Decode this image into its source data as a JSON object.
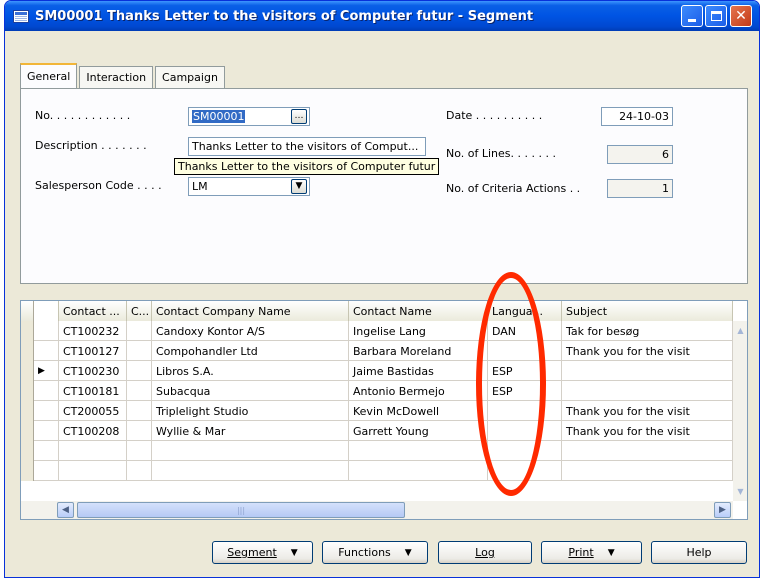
{
  "window": {
    "title": "SM00001 Thanks Letter to the visitors of Computer futur - Segment"
  },
  "tabs": [
    "General",
    "Interaction",
    "Campaign"
  ],
  "form": {
    "no_label": "No. . . . . . . . . . . .",
    "no_value": "SM00001",
    "description_label": "Description . . . . . . .",
    "description_value": "Thanks Letter to the visitors of Comput...",
    "description_tooltip": "Thanks Letter to the visitors of Computer futur",
    "salesperson_label": "Salesperson Code . . . .",
    "salesperson_value": "LM",
    "date_label": "Date . . . . . . . . . .",
    "date_value": "24-10-03",
    "lines_label": "No. of Lines. . . . . . .",
    "lines_value": "6",
    "criteria_label": "No. of Criteria Actions . .",
    "criteria_value": "1"
  },
  "grid": {
    "headers": [
      "Contact ...",
      "C...",
      "Contact Company Name",
      "Contact Name",
      "Langua...",
      "Subject"
    ],
    "rows": [
      {
        "contact": "CT100232",
        "c": "",
        "company": "Candoxy Kontor A/S",
        "name": "Ingelise Lang",
        "lang": "DAN",
        "subject": "Tak for besøg"
      },
      {
        "contact": "CT100127",
        "c": "",
        "company": "Compohandler Ltd",
        "name": "Barbara Moreland",
        "lang": "",
        "subject": "Thank you for the visit"
      },
      {
        "contact": "CT100230",
        "c": "",
        "company": "Libros S.A.",
        "name": "Jaime Bastidas",
        "lang": "ESP",
        "subject": ""
      },
      {
        "contact": "CT100181",
        "c": "",
        "company": "Subacqua",
        "name": "Antonio Bermejo",
        "lang": "ESP",
        "subject": ""
      },
      {
        "contact": "CT200055",
        "c": "",
        "company": "Triplelight Studio",
        "name": "Kevin McDowell",
        "lang": "",
        "subject": "Thank you for the visit"
      },
      {
        "contact": "CT100208",
        "c": "",
        "company": "Wyllie & Mar",
        "name": "Garrett Young",
        "lang": "",
        "subject": "Thank you for the visit"
      }
    ],
    "current_row": 2,
    "current_marker": "▶"
  },
  "buttons": {
    "segment": "Segment",
    "functions": "Functions",
    "log": "Log",
    "print": "Print",
    "help": "Help"
  },
  "colors": {
    "titlebar": "#0054e3",
    "annotation": "#ff2a00",
    "selection": "#316ac5",
    "tooltip": "#ffffe1"
  }
}
